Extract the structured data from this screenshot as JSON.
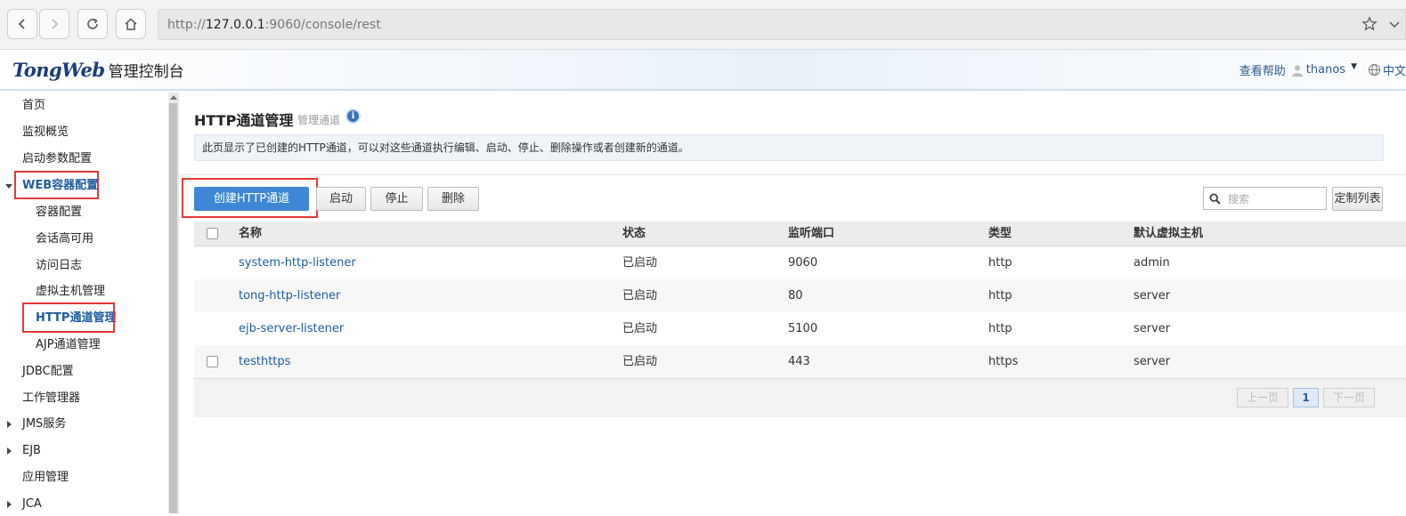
{
  "browser": {
    "url_scheme": "http://",
    "url_host": "127.0.0.1",
    "url_rest": ":9060/console/rest"
  },
  "header": {
    "logo_brand": "TongWeb",
    "logo_sub": "管理控制台",
    "help": "查看帮助",
    "user": "thanos",
    "language": "中文"
  },
  "sidebar": {
    "items": [
      {
        "label": "首页"
      },
      {
        "label": "监视概览"
      },
      {
        "label": "启动参数配置"
      },
      {
        "label": "WEB容器配置"
      },
      {
        "label": "容器配置"
      },
      {
        "label": "会话高可用"
      },
      {
        "label": "访问日志"
      },
      {
        "label": "虚拟主机管理"
      },
      {
        "label": "HTTP通道管理"
      },
      {
        "label": "AJP通道管理"
      },
      {
        "label": "JDBC配置"
      },
      {
        "label": "工作管理器"
      },
      {
        "label": "JMS服务"
      },
      {
        "label": "EJB"
      },
      {
        "label": "应用管理"
      },
      {
        "label": "JCA"
      }
    ]
  },
  "page": {
    "title": "HTTP通道管理",
    "subtitle": "管理通道",
    "info_icon": "i",
    "note": "此页显示了已创建的HTTP通道，可以对这些通道执行编辑、启动、停止、删除操作或者创建新的通道。"
  },
  "toolbar": {
    "create": "创建HTTP通道",
    "start": "启动",
    "stop": "停止",
    "delete": "删除",
    "search_placeholder": "搜索",
    "customize": "定制列表"
  },
  "table": {
    "headers": [
      "名称",
      "状态",
      "监听端口",
      "类型",
      "默认虚拟主机"
    ],
    "rows": [
      {
        "name": "system-http-listener",
        "status": "已启动",
        "port": "9060",
        "type": "http",
        "vhost": "admin"
      },
      {
        "name": "tong-http-listener",
        "status": "已启动",
        "port": "80",
        "type": "http",
        "vhost": "server"
      },
      {
        "name": "ejb-server-listener",
        "status": "已启动",
        "port": "5100",
        "type": "http",
        "vhost": "server"
      },
      {
        "name": "testhttps",
        "status": "已启动",
        "port": "443",
        "type": "https",
        "vhost": "server"
      }
    ]
  },
  "pagination": {
    "prev": "上一页",
    "current": "1",
    "next": "下一页"
  },
  "colors": {
    "accent": "#3d87d6",
    "link": "#1d5c9f",
    "highlight": "#e53935"
  }
}
